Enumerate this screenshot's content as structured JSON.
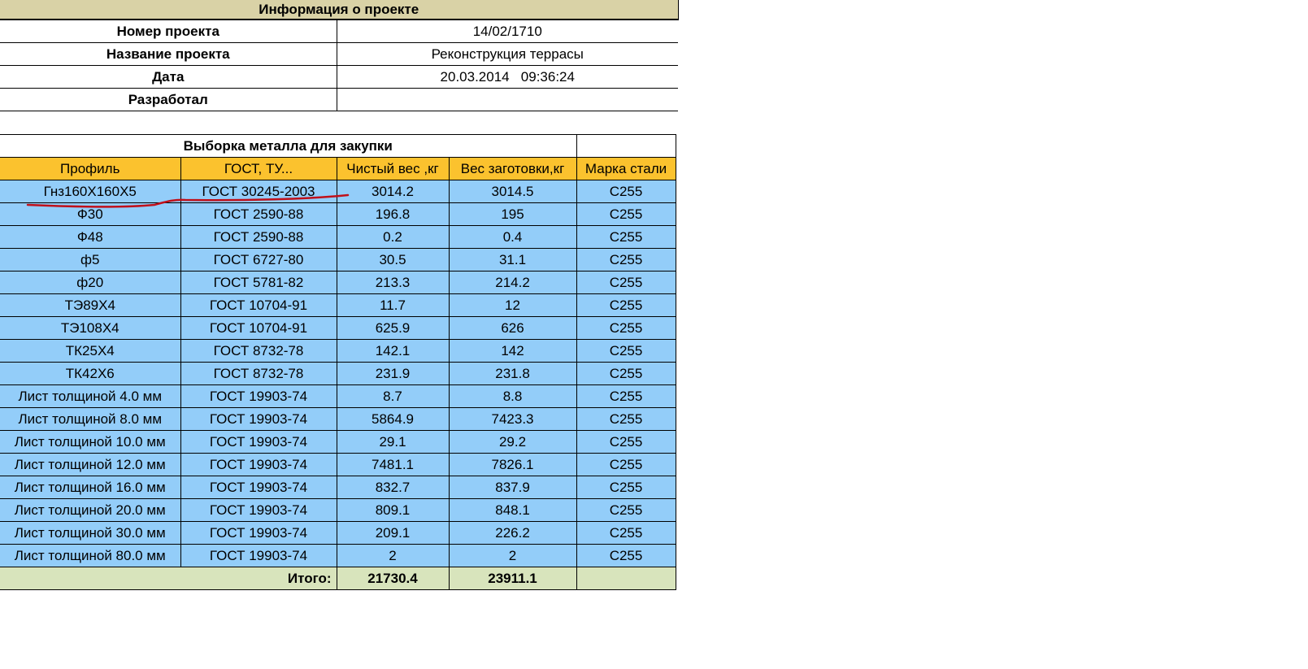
{
  "project_info": {
    "title": "Информация о проекте",
    "rows": [
      {
        "label": "Номер проекта",
        "value": "14/02/1710"
      },
      {
        "label": "Название проекта",
        "value": "Реконструкция террасы"
      },
      {
        "label": "Дата",
        "value": "20.03.2014   09:36:24"
      },
      {
        "label": "Разработал",
        "value": ""
      }
    ]
  },
  "metal_selection": {
    "title": "Выборка металла для закупки",
    "headers": [
      "Профиль",
      "ГОСТ, ТУ...",
      "Чистый вес ,кг",
      "Вес заготовки,кг",
      "Марка стали"
    ],
    "rows": [
      [
        "Гнз160Х160Х5",
        "ГОСТ 30245-2003",
        "3014.2",
        "3014.5",
        "С255"
      ],
      [
        "Ф30",
        "ГОСТ 2590-88",
        "196.8",
        "195",
        "С255"
      ],
      [
        "Ф48",
        "ГОСТ 2590-88",
        "0.2",
        "0.4",
        "С255"
      ],
      [
        "ф5",
        "ГОСТ 6727-80",
        "30.5",
        "31.1",
        "С255"
      ],
      [
        "ф20",
        "ГОСТ 5781-82",
        "213.3",
        "214.2",
        "С255"
      ],
      [
        "ТЭ89Х4",
        "ГОСТ 10704-91",
        "11.7",
        "12",
        "С255"
      ],
      [
        "ТЭ108Х4",
        "ГОСТ 10704-91",
        "625.9",
        "626",
        "С255"
      ],
      [
        "ТК25Х4",
        "ГОСТ 8732-78",
        "142.1",
        "142",
        "С255"
      ],
      [
        "ТК42Х6",
        "ГОСТ 8732-78",
        "231.9",
        "231.8",
        "С255"
      ],
      [
        "Лист толщиной 4.0 мм",
        "ГОСТ 19903-74",
        "8.7",
        "8.8",
        "С255"
      ],
      [
        "Лист толщиной 8.0 мм",
        "ГОСТ 19903-74",
        "5864.9",
        "7423.3",
        "С255"
      ],
      [
        "Лист толщиной 10.0 мм",
        "ГОСТ 19903-74",
        "29.1",
        "29.2",
        "С255"
      ],
      [
        "Лист толщиной 12.0 мм",
        "ГОСТ 19903-74",
        "7481.1",
        "7826.1",
        "С255"
      ],
      [
        "Лист толщиной 16.0 мм",
        "ГОСТ 19903-74",
        "832.7",
        "837.9",
        "С255"
      ],
      [
        "Лист толщиной 20.0 мм",
        "ГОСТ 19903-74",
        "809.1",
        "848.1",
        "С255"
      ],
      [
        "Лист толщиной 30.0 мм",
        "ГОСТ 19903-74",
        "209.1",
        "226.2",
        "С255"
      ],
      [
        "Лист толщиной 80.0 мм",
        "ГОСТ 19903-74",
        "2",
        "2",
        "С255"
      ]
    ],
    "total": {
      "label": "Итого:",
      "net_weight": "21730.4",
      "blank_weight": "23911.1",
      "steel": ""
    }
  },
  "colors": {
    "title_bg": "#d9d2a6",
    "header_bg": "#fbc22e",
    "row_bg": "#93cdf9",
    "total_bg": "#d8e4bc",
    "underline": "#c0101a"
  }
}
